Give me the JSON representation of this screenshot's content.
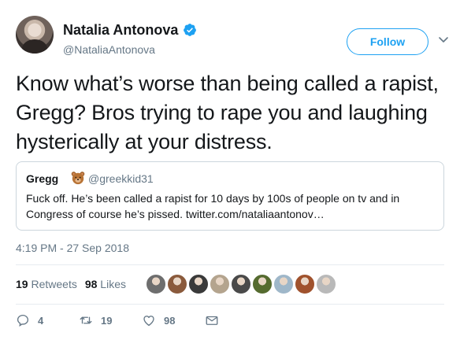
{
  "user": {
    "display_name": "Natalia Antonova",
    "handle": "@NataliaAntonova",
    "verified": true,
    "verified_icon": "verified-badge-icon",
    "avatar": "profile-photo"
  },
  "follow_label": "Follow",
  "menu_icon": "chevron-down-icon",
  "tweet": {
    "text": "Know what’s worse than being called a rapist, Gregg? Bros trying to rape you and laughing hysterically at your distress.",
    "timestamp": "4:19 PM - 27 Sep 2018"
  },
  "quote": {
    "name": "Gregg",
    "emoji_icon": "bear-face-icon",
    "handle": "@greekkid31",
    "text": "Fuck off. He’s been called a rapist for 10 days by 100s of people on tv and in Congress of course he’s pissed. twitter.com/nataliaantonov…"
  },
  "stats": {
    "retweets_count": "19",
    "retweets_label": "Retweets",
    "likes_count": "98",
    "likes_label": "Likes"
  },
  "likers": [
    {
      "color": "#6e6e6e"
    },
    {
      "color": "#8a5a3c"
    },
    {
      "color": "#3a3a3a"
    },
    {
      "color": "#b4a48e"
    },
    {
      "color": "#4a4a4a"
    },
    {
      "color": "#556b2f"
    },
    {
      "color": "#9fb7c9"
    },
    {
      "color": "#a0522d"
    },
    {
      "color": "#b9b9b9"
    }
  ],
  "actions": {
    "reply_count": "4",
    "retweet_count": "19",
    "like_count": "98"
  },
  "colors": {
    "accent": "#1da1f2",
    "secondary_text": "#657786",
    "border": "#ccd6dd"
  }
}
